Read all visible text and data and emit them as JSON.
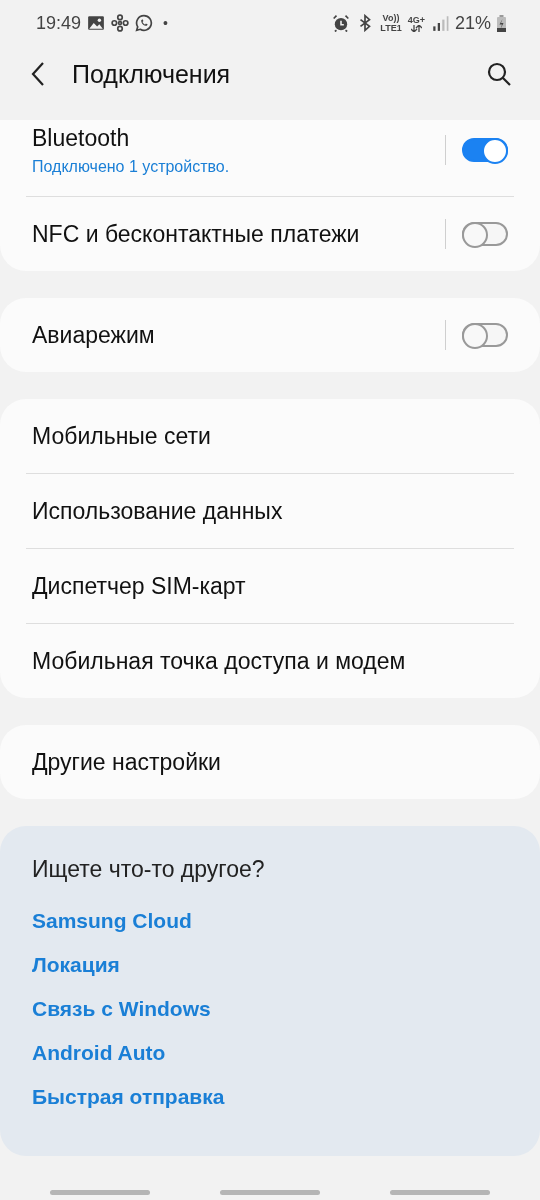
{
  "status_bar": {
    "time": "19:49",
    "dot": "•",
    "volte": "Vo))",
    "lte": "LTE1",
    "network": "4G+",
    "battery": "21%"
  },
  "header": {
    "title": "Подключения"
  },
  "groups": [
    {
      "items": [
        {
          "label": "Bluetooth",
          "subtitle": "Подключено 1 устройство.",
          "kind": "toggle",
          "on": true
        },
        {
          "label": "NFC и бесконтактные платежи",
          "kind": "toggle",
          "on": false
        }
      ]
    },
    {
      "items": [
        {
          "label": "Авиарежим",
          "kind": "toggle",
          "on": false
        }
      ]
    },
    {
      "items": [
        {
          "label": "Мобильные сети",
          "kind": "link"
        },
        {
          "label": "Использование данных",
          "kind": "link"
        },
        {
          "label": "Диспетчер SIM-карт",
          "kind": "link"
        },
        {
          "label": "Мобильная точка доступа и модем",
          "kind": "link"
        }
      ]
    },
    {
      "items": [
        {
          "label": "Другие настройки",
          "kind": "link"
        }
      ]
    }
  ],
  "suggestions": {
    "title": "Ищете что-то другое?",
    "links": [
      "Samsung Cloud",
      "Локация",
      "Связь с Windows",
      "Android Auto",
      "Быстрая отправка"
    ]
  }
}
